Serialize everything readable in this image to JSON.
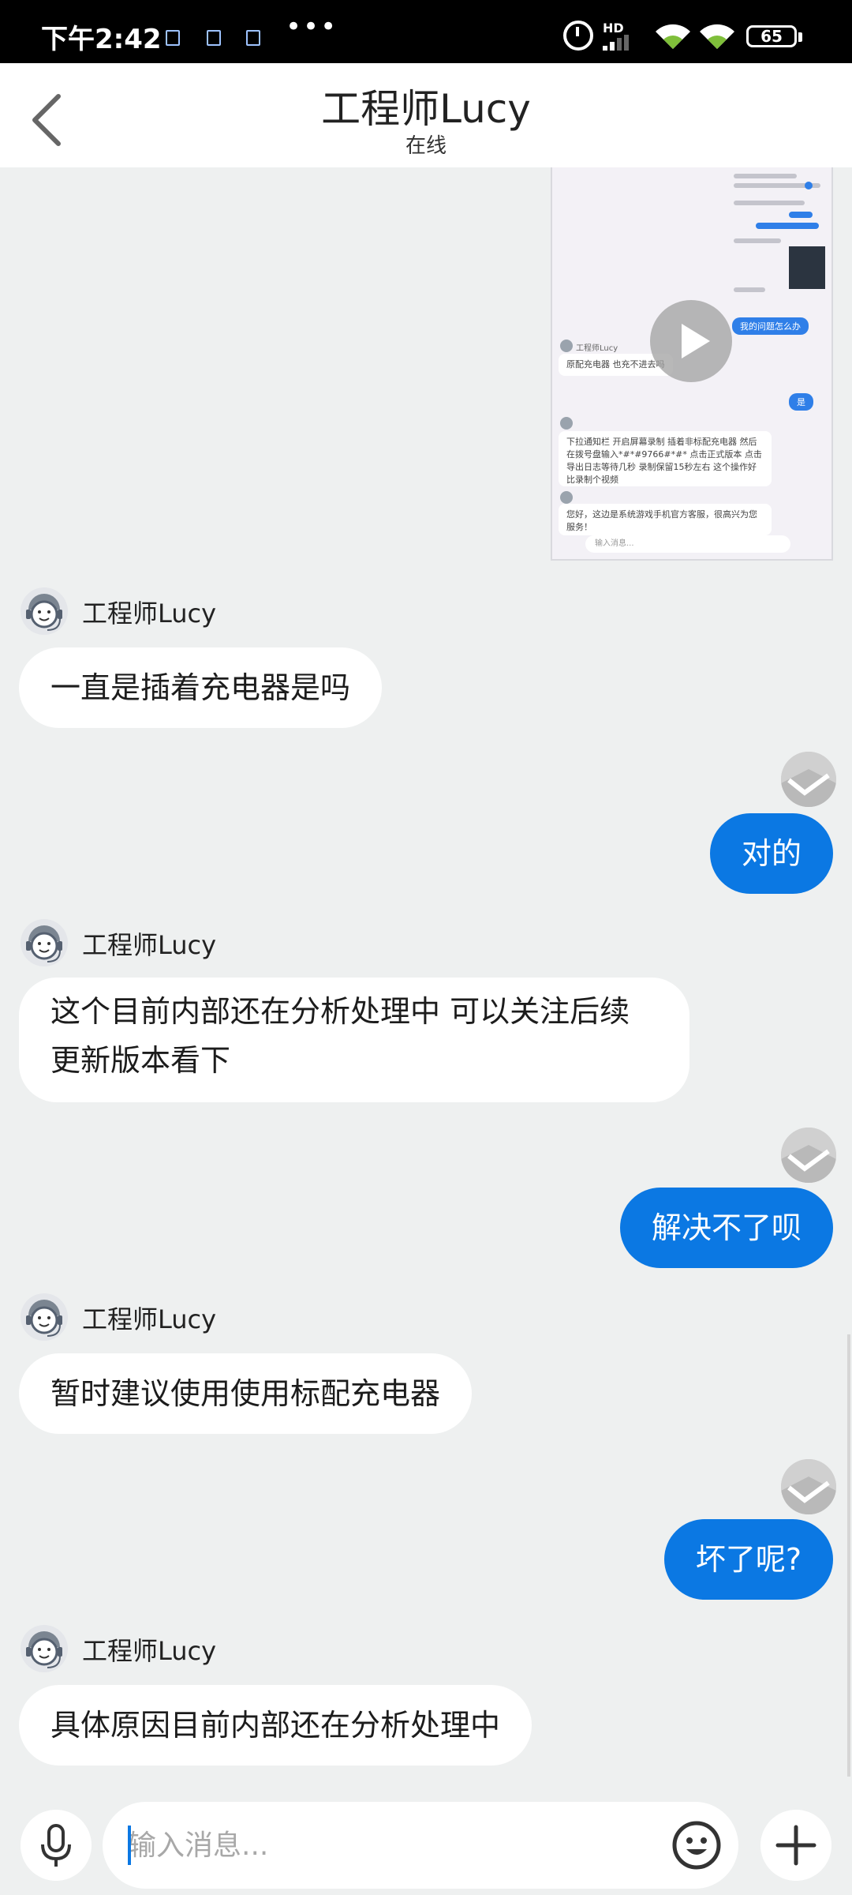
{
  "status_bar": {
    "time": "下午2:42",
    "more_dots": "•••",
    "hd_label": "HD",
    "battery": "65"
  },
  "header": {
    "title": "工程师Lucy",
    "status": "在线"
  },
  "screenshot_thumb": {
    "name_a": "工程师Lucy",
    "msg_a": "原配充电器 也充不进去吗",
    "blue_a": "我的问题怎么办",
    "blue_b": "是",
    "msg_b": "下拉通知栏 开启屏幕录制 插着非标配充电器 然后在拨号盘输入*#*#9766#*#* 点击正式版本 点击导出日志等待几秒 录制保留15秒左右 这个操作好比录制个视频",
    "msg_c": "您好，这边是系统游戏手机官方客服，很高兴为您服务！",
    "input_placeholder": "输入消息..."
  },
  "messages": [
    {
      "sender": "agent",
      "name": "工程师Lucy",
      "text": "一直是插着充电器是吗"
    },
    {
      "sender": "user",
      "text": "对的"
    },
    {
      "sender": "agent",
      "name": "工程师Lucy",
      "text": "这个目前内部还在分析处理中  可以关注后续更新版本看下"
    },
    {
      "sender": "user",
      "text": "解决不了呗"
    },
    {
      "sender": "agent",
      "name": "工程师Lucy",
      "text": "暂时建议使用使用标配充电器"
    },
    {
      "sender": "user",
      "text": "坏了呢?"
    },
    {
      "sender": "agent",
      "name": "工程师Lucy",
      "text": "具体原因目前内部还在分析处理中"
    }
  ],
  "input_bar": {
    "placeholder": "输入消息..."
  },
  "colors": {
    "accent": "#0b78e3",
    "background": "#eef0f0"
  }
}
